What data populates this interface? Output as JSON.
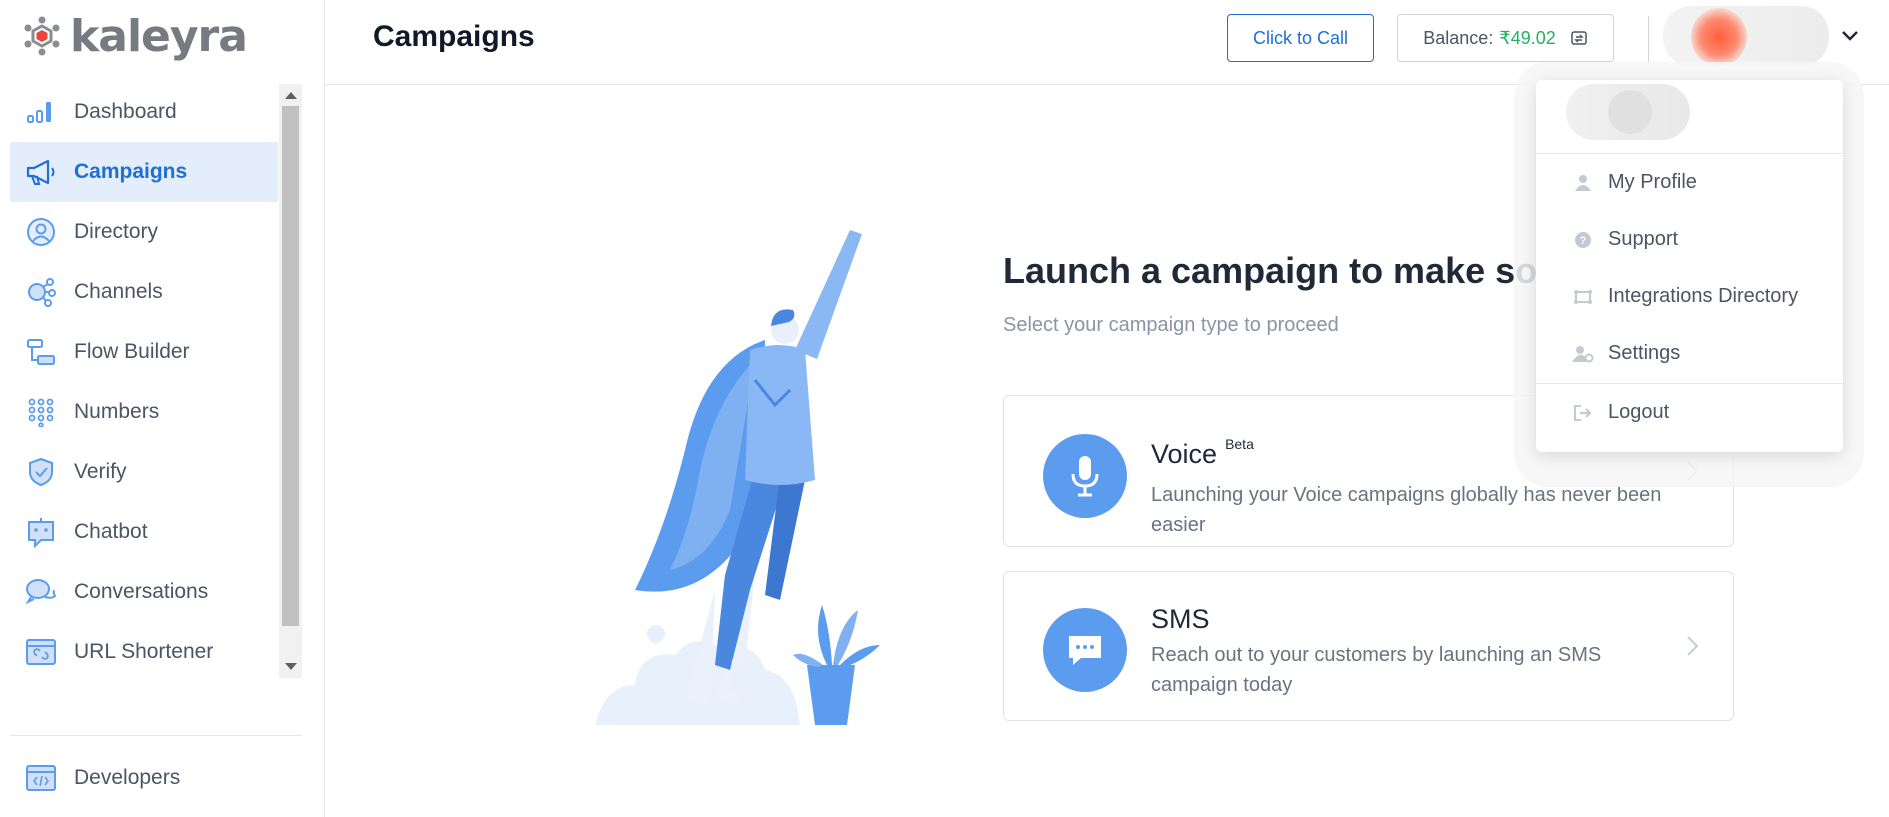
{
  "brand": {
    "name": "kaleyra"
  },
  "sidebar": {
    "items": [
      {
        "label": "Dashboard",
        "icon": "bar-chart-icon",
        "active": false
      },
      {
        "label": "Campaigns",
        "icon": "megaphone-icon",
        "active": true
      },
      {
        "label": "Directory",
        "icon": "user-circle-icon",
        "active": false
      },
      {
        "label": "Channels",
        "icon": "network-icon",
        "active": false
      },
      {
        "label": "Flow Builder",
        "icon": "flow-icon",
        "active": false
      },
      {
        "label": "Numbers",
        "icon": "dial-pad-icon",
        "active": false
      },
      {
        "label": "Verify",
        "icon": "shield-check-icon",
        "active": false
      },
      {
        "label": "Chatbot",
        "icon": "robot-icon",
        "active": false
      },
      {
        "label": "Conversations",
        "icon": "chat-bubbles-icon",
        "active": false
      },
      {
        "label": "URL Shortener",
        "icon": "link-icon",
        "active": false
      }
    ],
    "footer_item": {
      "label": "Developers",
      "icon": "code-icon"
    }
  },
  "header": {
    "title": "Campaigns",
    "click_to_call": "Click to Call",
    "balance_label": "Balance:",
    "balance_value": "₹49.02"
  },
  "main": {
    "headline": "Launch a campaign to make som",
    "subtitle": "Select your campaign type to proceed",
    "cards": [
      {
        "title": "Voice",
        "badge": "Beta",
        "description": "Launching your Voice campaigns globally has never been easier",
        "icon": "microphone-icon"
      },
      {
        "title": "SMS",
        "badge": "",
        "description": "Reach out to your customers by launching an SMS campaign today",
        "icon": "message-icon"
      }
    ]
  },
  "user_menu": {
    "items": [
      {
        "label": "My Profile",
        "icon": "user-icon"
      },
      {
        "label": "Support",
        "icon": "help-icon"
      },
      {
        "label": "Integrations Directory",
        "icon": "integrations-icon"
      },
      {
        "label": "Settings",
        "icon": "user-settings-icon"
      }
    ],
    "logout": {
      "label": "Logout",
      "icon": "logout-icon"
    }
  },
  "colors": {
    "accent": "#1f6fd6",
    "active_bg": "#e3edfb",
    "balance_green": "#22b35e",
    "card_icon_bg": "#5b9cee",
    "logo_red": "#e8453c"
  }
}
